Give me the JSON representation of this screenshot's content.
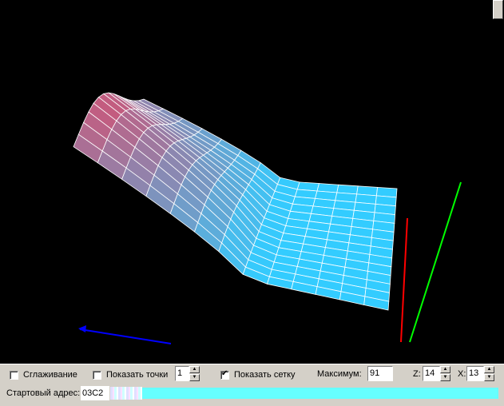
{
  "viewer": {
    "axes": {
      "x_axis_color": "#0000ff",
      "y_axis_color": "#ff0000",
      "z_axis_color": "#00ff00"
    },
    "surface": {
      "low_color": "#33ccff",
      "high_color": "#cc5577",
      "grid_color": "#ffffff"
    }
  },
  "controls": {
    "smoothing_label": "Сглаживание",
    "smoothing_checked": false,
    "show_points_label": "Показать точки",
    "show_points_checked": false,
    "points_size_value": "1",
    "show_grid_label": "Показать сетку",
    "show_grid_checked": true,
    "maximum_label": "Максимум:",
    "maximum_value": "91",
    "z_label": "Z:",
    "z_value": "14",
    "x_label": "X:",
    "x_value": "13",
    "start_address_label": "Стартовый адрес:",
    "start_address_value": "03C2"
  }
}
